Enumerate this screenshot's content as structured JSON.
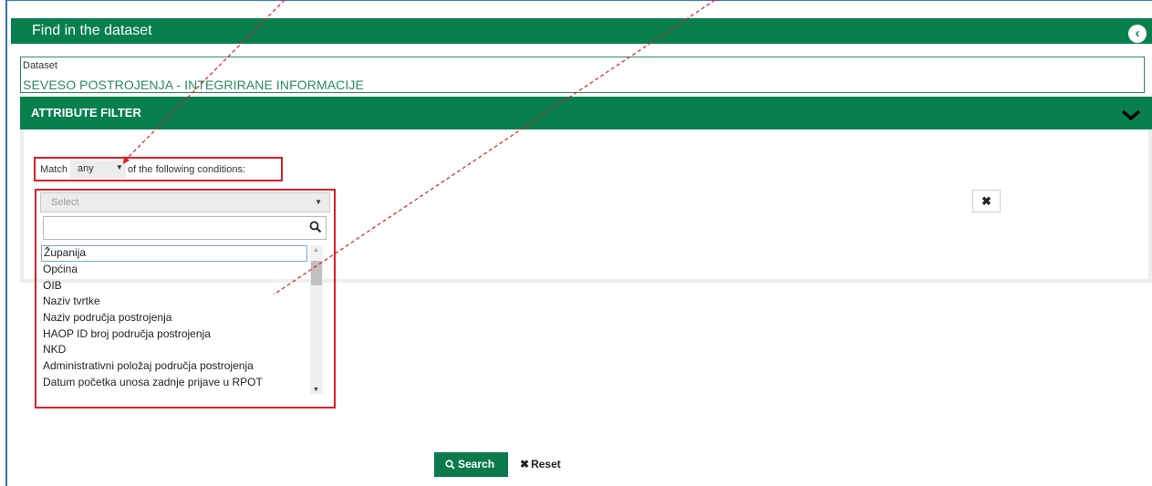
{
  "header": {
    "title": "Find in the dataset",
    "collapse_icon": "chevron-left-circle-icon"
  },
  "dataset": {
    "label": "Dataset",
    "value": "SEVESO POSTROJENJA - INTEGRIRANE INFORMACIJE"
  },
  "attribute_filter": {
    "title": "ATTRIBUTE FILTER",
    "toggle_icon": "chevron-down-icon",
    "match": {
      "prefix": "Match",
      "selected": "any",
      "suffix": "of the following conditions:"
    },
    "condition": {
      "placeholder": "Select",
      "search_value": "",
      "options": [
        "Županija",
        "Općina",
        "OIB",
        "Naziv tvrtke",
        "Naziv područja postrojenja",
        "HAOP ID broj područja postrojenja",
        "NKD",
        "Administrativni položaj područja postrojenja",
        "Datum početka unosa zadnje prijave u RPOT"
      ]
    },
    "remove_icon": "close-icon"
  },
  "actions": {
    "search_label": "Search",
    "reset_label": "Reset"
  },
  "colors": {
    "brand_green": "#07804e",
    "highlight_red": "#e11d27",
    "annotation_arrow": "#e11d27"
  }
}
